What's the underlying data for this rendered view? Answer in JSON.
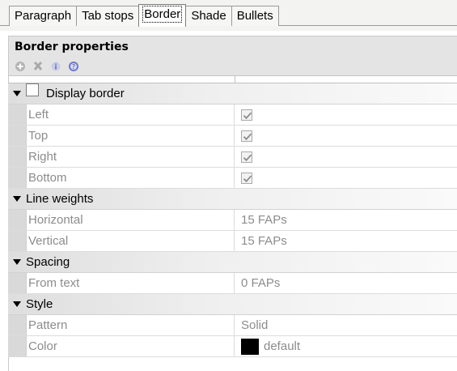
{
  "tabs": [
    {
      "label": "Paragraph",
      "active": false
    },
    {
      "label": "Tab stops",
      "active": false
    },
    {
      "label": "Border",
      "active": true
    },
    {
      "label": "Shade",
      "active": false
    },
    {
      "label": "Bullets",
      "active": false
    }
  ],
  "panel": {
    "title": "Border properties",
    "toolbar": [
      {
        "icon": "add-icon"
      },
      {
        "icon": "delete-icon"
      },
      {
        "icon": "info-icon"
      },
      {
        "icon": "help-icon"
      }
    ]
  },
  "categories": {
    "display_border": {
      "label": "Display border",
      "checked": false,
      "props": {
        "left": {
          "label": "Left",
          "checked": true
        },
        "top": {
          "label": "Top",
          "checked": true
        },
        "right": {
          "label": "Right",
          "checked": true
        },
        "bottom": {
          "label": "Bottom",
          "checked": true
        }
      }
    },
    "line_weights": {
      "label": "Line weights",
      "props": {
        "horizontal": {
          "label": "Horizontal",
          "value": "15 FAPs"
        },
        "vertical": {
          "label": "Vertical",
          "value": "15 FAPs"
        }
      }
    },
    "spacing": {
      "label": "Spacing",
      "props": {
        "from_text": {
          "label": "From text",
          "value": "0 FAPs"
        }
      }
    },
    "style": {
      "label": "Style",
      "props": {
        "pattern": {
          "label": "Pattern",
          "value": "Solid"
        },
        "color": {
          "label": "Color",
          "value": "default",
          "swatch": "#000000"
        }
      }
    }
  }
}
